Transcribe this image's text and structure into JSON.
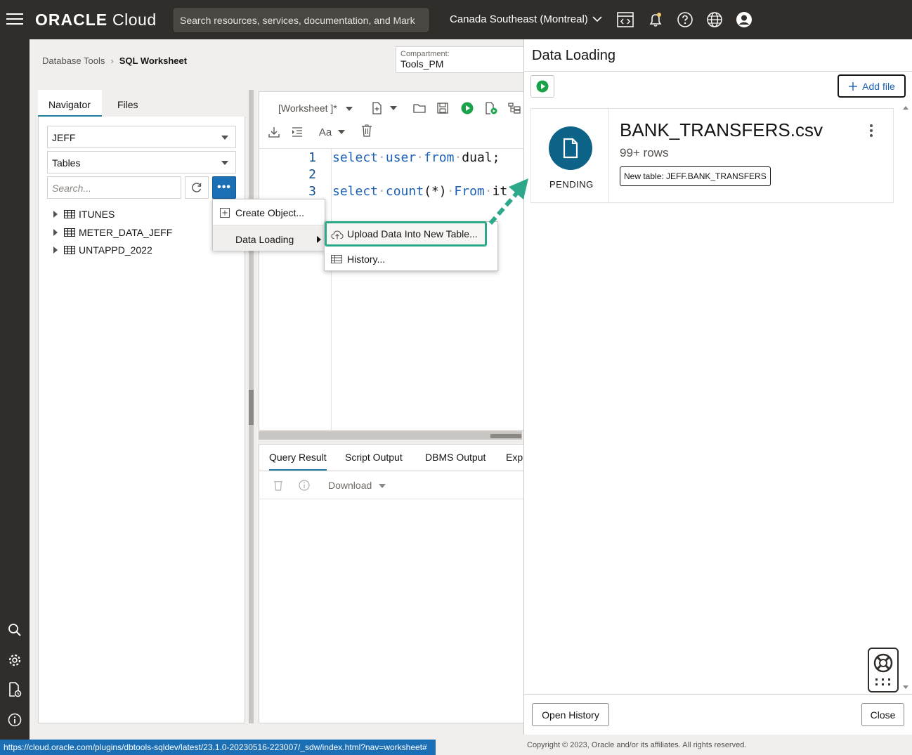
{
  "topbar": {
    "logo_brand": "ORACLE",
    "logo_product": "Cloud",
    "search_placeholder": "Search resources, services, documentation, and Mark",
    "region": "Canada Southeast (Montreal)"
  },
  "breadcrumb": {
    "parent": "Database Tools",
    "current": "SQL Worksheet"
  },
  "compartment": {
    "label": "Compartment:",
    "value": "Tools_PM"
  },
  "navigator": {
    "tabs": [
      "Navigator",
      "Files"
    ],
    "schema": "JEFF",
    "object_type": "Tables",
    "search_placeholder": "Search...",
    "more_label": "•••",
    "tables": [
      "ITUNES",
      "METER_DATA_JEFF",
      "UNTAPPD_2022"
    ]
  },
  "menu": {
    "create_object": "Create Object...",
    "data_loading": "Data Loading",
    "upload": "Upload Data Into New Table...",
    "history": "History..."
  },
  "editor": {
    "worksheet_name": "[Worksheet ]*",
    "font_label": "Aa",
    "lines": [
      "1",
      "2",
      "3"
    ]
  },
  "code": {
    "l1_kw1": "select",
    "l1_kw2": "user",
    "l1_kw3": "from",
    "l1_rest": "dual;",
    "l3_kw1": "select",
    "l3_kw2": "count",
    "l3_paren": "(*)",
    "l3_kw3": "From",
    "l3_rest": "it"
  },
  "results": {
    "tabs": [
      "Query Result",
      "Script Output",
      "DBMS Output",
      "Expl"
    ],
    "download": "Download"
  },
  "data_loading": {
    "title": "Data Loading",
    "add_file": "Add file",
    "file_name": "BANK_TRANSFERS.csv",
    "rows": "99+ rows",
    "new_table": "New table: JEFF.BANK_TRANSFERS",
    "status": "PENDING",
    "open_history": "Open History",
    "close": "Close"
  },
  "status_bar": {
    "url": "https://cloud.oracle.com/plugins/dbtools-sqldev/latest/23.1.0-20230516-223007/_sdw/index.html?nav=worksheet#",
    "copyright": "Copyright © 2023, Oracle and/or its affiliates. All rights reserved."
  },
  "colors": {
    "accent": "#1b6fb5",
    "highlight": "#2ea88b",
    "file_icon": "#0c6287",
    "run": "#1aa34a"
  }
}
